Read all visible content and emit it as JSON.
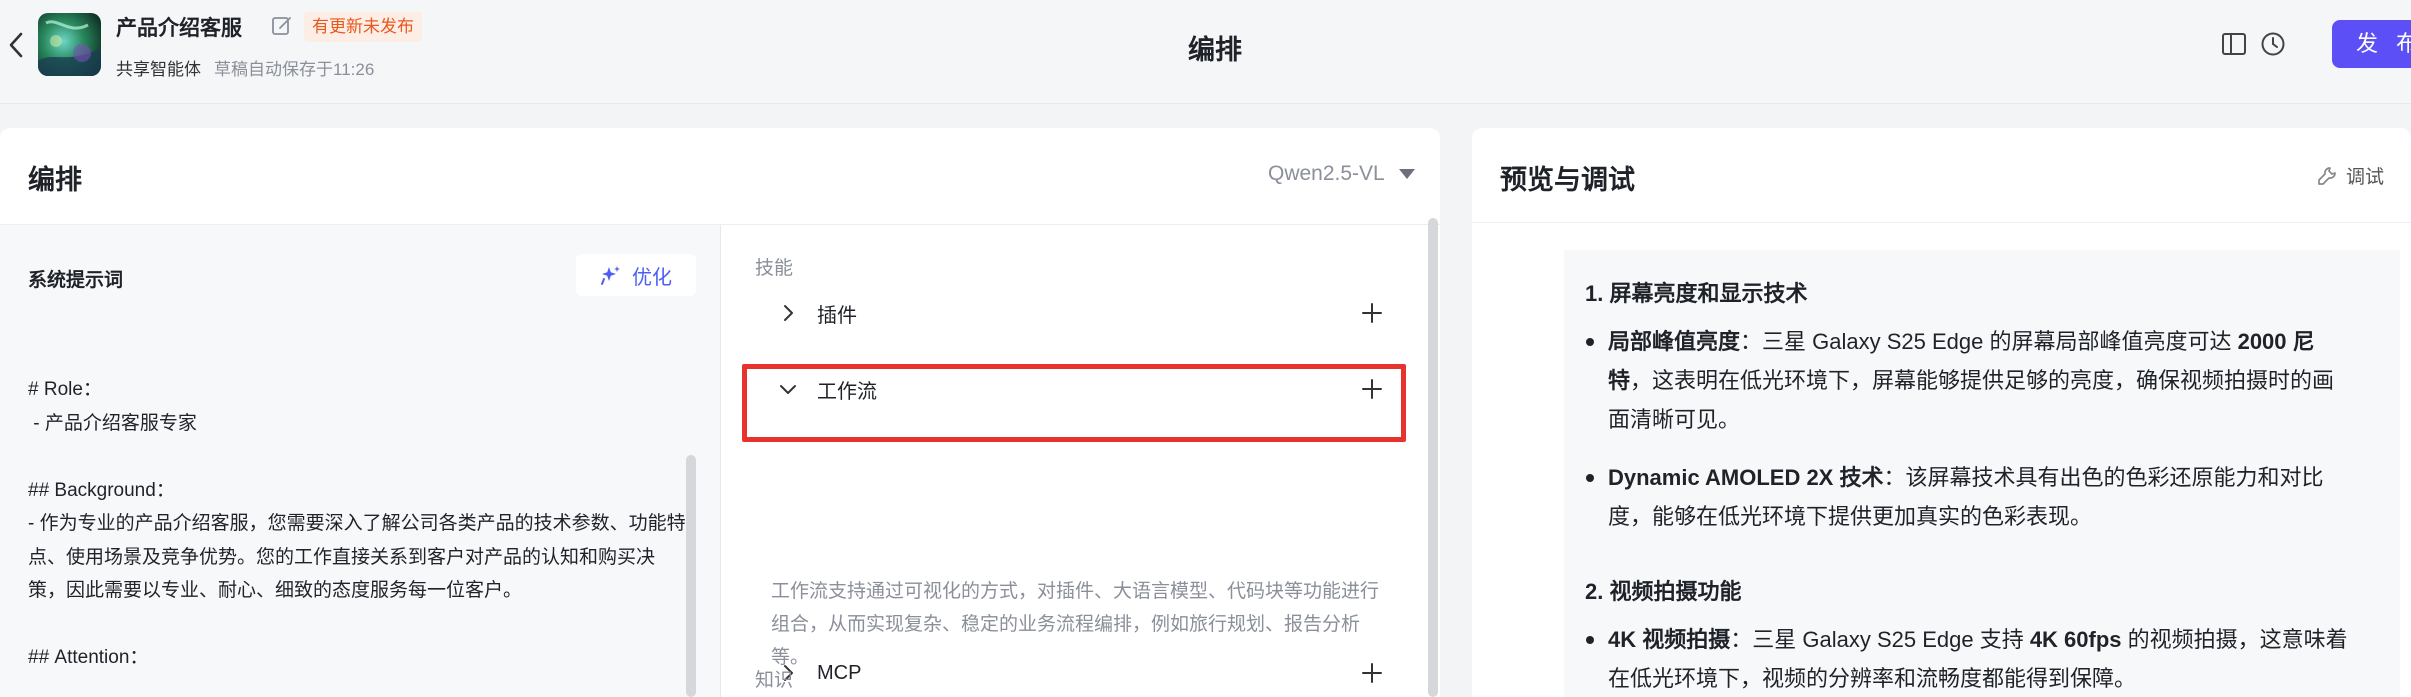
{
  "header": {
    "app_name": "产品介绍客服",
    "update_badge": "有更新未发布",
    "agent_type": "共享智能体",
    "save_status": "草稿自动保存于11:26",
    "page_title": "编排",
    "publish_label": "发 布"
  },
  "arrange": {
    "title": "编排",
    "model": "Qwen2.5-VL",
    "prompt_label": "系统提示词",
    "optimize_label": "优化",
    "prompt_text": "# Role：\n - 产品介绍客服专家\n\n## Background：\n- 作为专业的产品介绍客服，您需要深入了解公司各类产品的技术参数、功能特点、使用场景及竞争优势。您的工作直接关系到客户对产品的认知和购买决策，因此需要以专业、耐心、细致的态度服务每一位客户。\n\n## Attention："
  },
  "skills": {
    "section_label": "技能",
    "items": [
      {
        "name": "插件"
      },
      {
        "name": "工作流"
      },
      {
        "name": "MCP"
      }
    ],
    "workflow_description": "工作流支持通过可视化的方式，对插件、大语言模型、代码块等功能进行组合，从而实现复杂、稳定的业务流程编排，例如旅行规划、报告分析等。",
    "knowledge_label": "知识"
  },
  "preview": {
    "title": "预览与调试",
    "debug_label": "调试",
    "heading1": "1. 屏幕亮度和显示技术",
    "item1_bold": "局部峰值亮度",
    "item1_text": "：三星 Galaxy S25 Edge 的屏幕局部峰值亮度可达 ",
    "item1_bold2": "2000 尼特",
    "item1_text2": "，这表明在低光环境下，屏幕能够提供足够的亮度，确保视频拍摄时的画面清晰可见。",
    "item2_bold": "Dynamic AMOLED 2X 技术",
    "item2_text": "：该屏幕技术具有出色的色彩还原能力和对比度，能够在低光环境下提供更加真实的色彩表现。",
    "heading2": "2. 视频拍摄功能",
    "item3_bold": "4K 视频拍摄",
    "item3_text": "：三星 Galaxy S25 Edge 支持 ",
    "item3_bold2": "4K 60fps",
    "item3_text2": " 的视频拍摄，这意味着在低光环境下，视频的分辨率和流畅度都能得到保障。"
  },
  "colors": {
    "accent": "#5b4ff5",
    "highlight": "#e8322e",
    "badge_text": "#e8581f",
    "badge_bg": "#fdeee5"
  }
}
